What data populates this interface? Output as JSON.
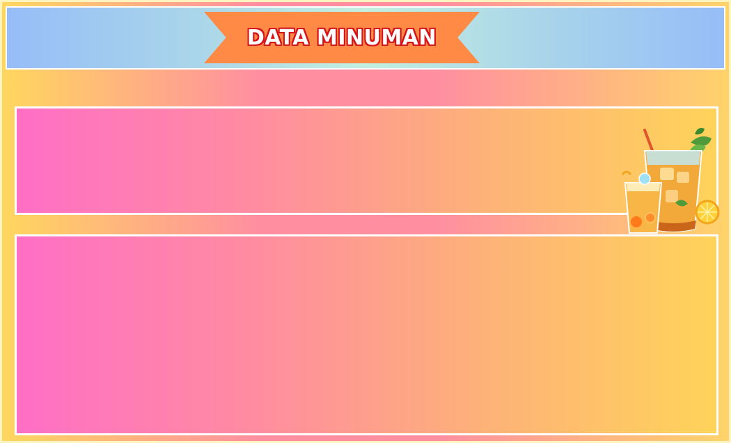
{
  "header": {
    "title": "DATA MINUMAN"
  },
  "illustration": {
    "icon": "iced-tea-drinks-icon"
  },
  "colors": {
    "banner": "#ff8a45",
    "title_outline": "#d4151b",
    "panel_start": "#ff6fc5",
    "panel_end": "#ffd35a"
  }
}
